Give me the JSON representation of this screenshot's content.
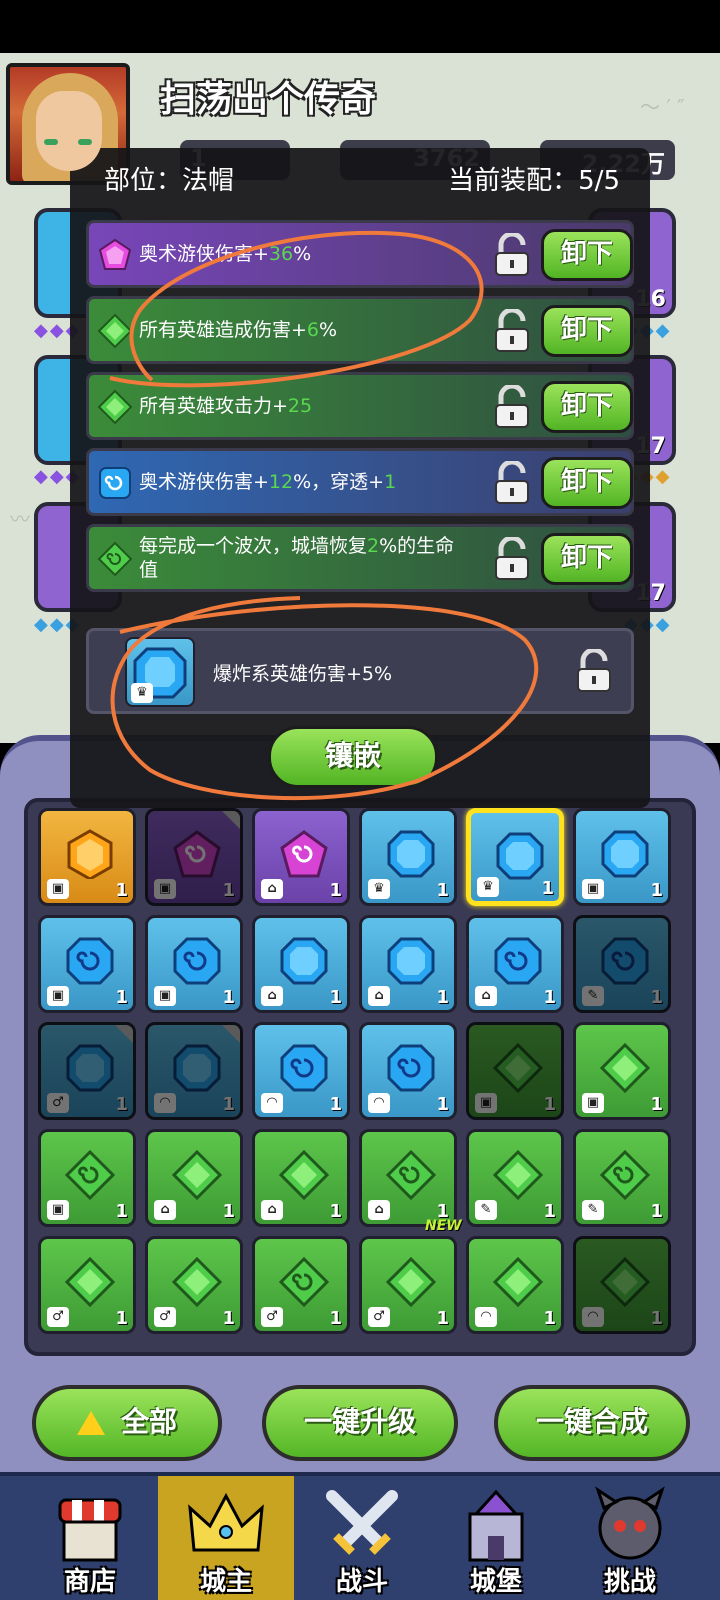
{
  "player": {
    "name": "扫荡出个传奇"
  },
  "resources": {
    "power_partial": "3762",
    "gold_partial": "2.22万",
    "gem_partial": "1"
  },
  "side_levels": {
    "right_1": "16",
    "right_2": "17",
    "right_3": "17"
  },
  "panel": {
    "slot_label": "部位：法帽",
    "equip_label": "当前装配：5/5",
    "attributes": [
      {
        "color": "purple",
        "gem": "purple-pentagon-gem",
        "pre": "奥术游侠伤害+",
        "num": "36",
        "post": "%"
      },
      {
        "color": "green",
        "gem": "green-diamond-gem",
        "pre": "所有英雄造成伤害+",
        "num": "6",
        "post": "%"
      },
      {
        "color": "green",
        "gem": "green-diamond-gem",
        "pre": "所有英雄攻击力+",
        "num": "25",
        "post": ""
      },
      {
        "color": "blue",
        "gem": "blue-swirl-gem",
        "pre": "奥术游侠伤害+",
        "num": "12",
        "post": "%，穿透+",
        "num2": "1"
      },
      {
        "color": "green",
        "gem": "green-swirl-gem",
        "pre": "每完成一个波次，城墙恢复",
        "num": "2",
        "post": "%的生命值"
      }
    ],
    "unload_label": "卸下",
    "new_gem_text": "爆炸系英雄伤害+5%",
    "inlay_label": "镶嵌"
  },
  "grid_count": "1",
  "new_tag": "NEW",
  "bottom_buttons": {
    "all": "全部",
    "upgrade": "一键升级",
    "merge": "一键合成"
  },
  "tabs": [
    "商店",
    "城主",
    "战斗",
    "城堡",
    "挑战"
  ],
  "active_tab": "城主",
  "colors": {
    "green_value": "#59d84f",
    "annotation": "#f07a3c",
    "accent": "#ffe21d"
  }
}
